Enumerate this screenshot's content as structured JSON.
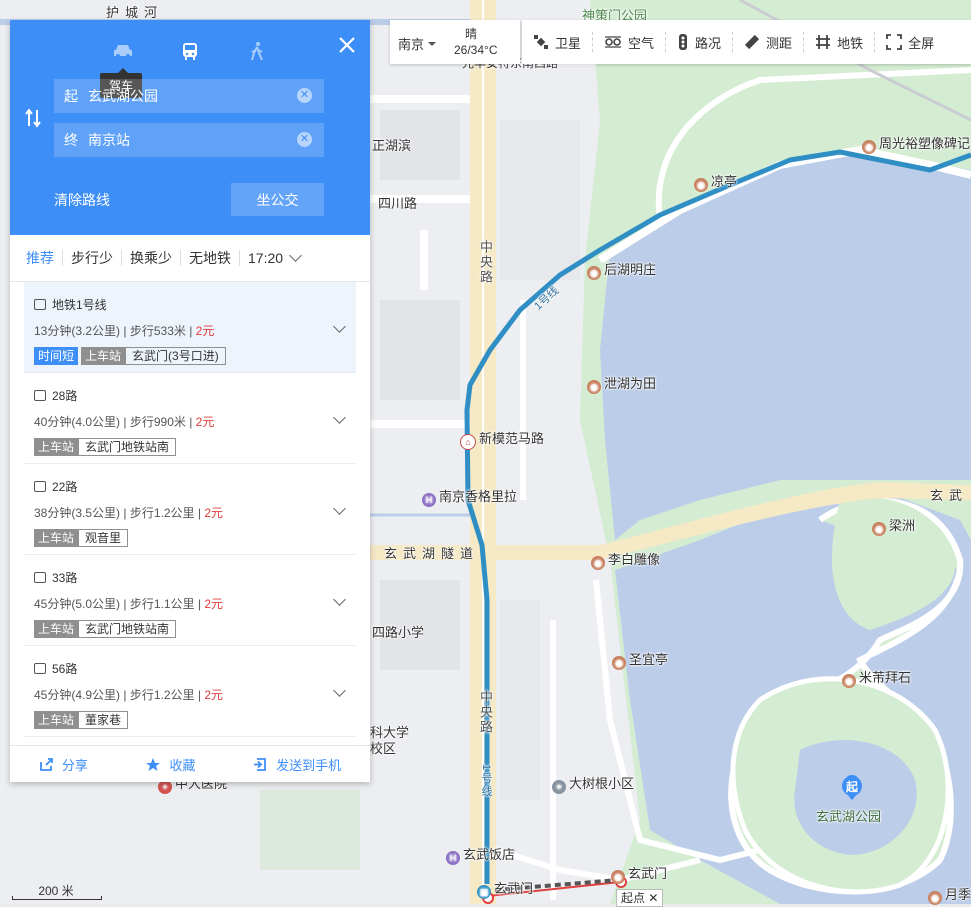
{
  "panel": {
    "modes": [
      {
        "name": "drive",
        "icon": "car-icon",
        "tooltip": "驾车"
      },
      {
        "name": "bus",
        "icon": "bus-icon"
      },
      {
        "name": "walk",
        "icon": "walk-icon"
      }
    ],
    "active_tooltip": "驾车",
    "start": {
      "tag": "起",
      "value": "玄武湖公园"
    },
    "end": {
      "tag": "终",
      "value": "南京站"
    },
    "clear_label": "清除路线",
    "bus_button_label": "坐公交",
    "filters": [
      "推荐",
      "步行少",
      "换乘少",
      "无地铁"
    ],
    "time": "17:20",
    "routes": [
      {
        "title": "地铁1号线",
        "duration": "13分钟",
        "distance": "(3.2公里)",
        "walk": "步行533米",
        "price": "2元",
        "fast_tag": "时间短",
        "board_label": "上车站",
        "station": "玄武门(3号口进)"
      },
      {
        "title": "28路",
        "duration": "40分钟",
        "distance": "(4.0公里)",
        "walk": "步行990米",
        "price": "2元",
        "fast_tag": "",
        "board_label": "上车站",
        "station": "玄武门地铁站南"
      },
      {
        "title": "22路",
        "duration": "38分钟",
        "distance": "(3.5公里)",
        "walk": "步行1.2公里",
        "price": "2元",
        "fast_tag": "",
        "board_label": "上车站",
        "station": "观音里"
      },
      {
        "title": "33路",
        "duration": "45分钟",
        "distance": "(5.0公里)",
        "walk": "步行1.1公里",
        "price": "2元",
        "fast_tag": "",
        "board_label": "上车站",
        "station": "玄武门地铁站南"
      },
      {
        "title": "56路",
        "duration": "45分钟",
        "distance": "(4.9公里)",
        "walk": "步行1.2公里",
        "price": "2元",
        "fast_tag": "",
        "board_label": "上车站",
        "station": "董家巷"
      }
    ],
    "footer": {
      "share": "分享",
      "favorite": "收藏",
      "send": "发送到手机"
    }
  },
  "weather": {
    "city": "南京",
    "condition": "晴",
    "temp": "26/34°C"
  },
  "toolbar": [
    "卫星",
    "空气",
    "路况",
    "测距",
    "地铁",
    "全屏"
  ],
  "map": {
    "labels": {
      "huchenghe": "护城河",
      "shence": "神策门公园",
      "guangzhou": "光华安特东南西路",
      "zhenghubin": "正湖滨",
      "sichuan": "四川路",
      "zhongyang1": "中央路",
      "zhougy": "周光裕塑像碑记",
      "liangting": "凉亭",
      "houhu": "后湖明庄",
      "line1": "1号线",
      "xiehu": "泄湖为田",
      "xinmofan": "新模范马路",
      "shangrila": "南京香格里拉",
      "tunnel": "玄武湖隧道",
      "xuanwu_right": "玄武",
      "liangzhou": "梁洲",
      "libai": "李白雕像",
      "shengyi": "圣宜亭",
      "mifu": "米芾拜石",
      "xuanwupark": "玄武湖公园",
      "qi": "起",
      "dashugen": "大树根小区",
      "zhongyang2": "中央路",
      "line1b": "1号线",
      "fandian": "玄武饭店",
      "xuanwumen_subway": "玄武门",
      "xuanwumen": "玄武门",
      "yueji": "月季",
      "xiaoxue": "四路小学",
      "ligong": "科大学",
      "xiaoqu": "校区",
      "hospital": "中大医院",
      "start_popup": "起点"
    }
  },
  "scale": {
    "label": "200 米"
  },
  "colors": {
    "accent": "#3e8ef7",
    "route": "#2f8fc4",
    "water": "#bfd0ea",
    "green": "#d2ecd0",
    "price": "#e03b3b"
  }
}
